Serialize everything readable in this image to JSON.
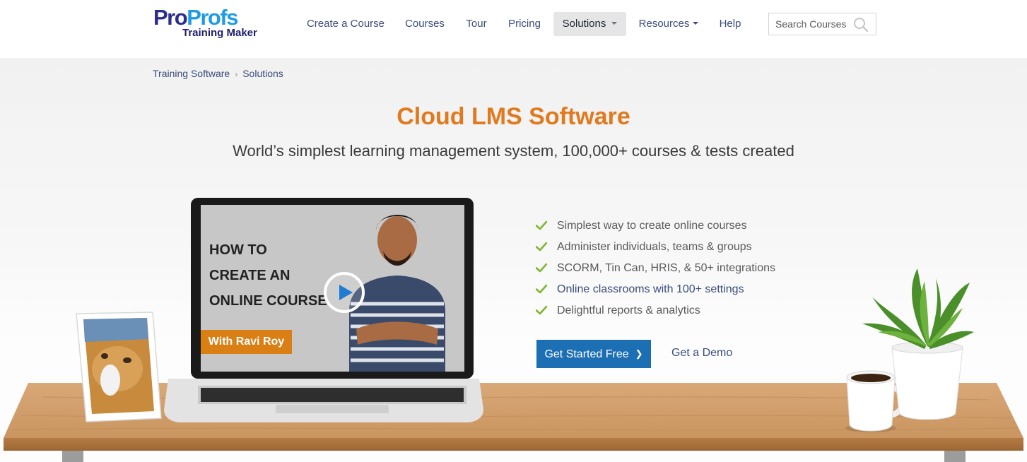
{
  "header": {
    "logo": {
      "main_pro": "Pro",
      "main_profs": "Profs",
      "sub": "Training Maker"
    },
    "nav": [
      {
        "label": "Create a Course"
      },
      {
        "label": "Courses"
      },
      {
        "label": "Tour"
      },
      {
        "label": "Pricing"
      },
      {
        "label": "Solutions",
        "active": true,
        "dropdown": true
      },
      {
        "label": "Resources",
        "dropdown": true
      },
      {
        "label": "Help"
      }
    ],
    "search": {
      "placeholder": "Search Courses",
      "icon": "search-icon"
    }
  },
  "breadcrumb": {
    "items": [
      "Training Software",
      "Solutions"
    ],
    "separator": "›"
  },
  "hero": {
    "title": "Cloud LMS Software",
    "subtitle": "World’s simplest learning management system, 100,000+ courses & tests created",
    "features": [
      "Simplest way to create online courses",
      "Administer individuals, teams & groups",
      "SCORM, Tin Can, HRIS, & 50+ integrations",
      "Online classrooms with 100+ settings",
      "Delightful reports & analytics"
    ],
    "primary_cta": "Get Started Free",
    "secondary_cta": "Get a Demo"
  },
  "video": {
    "heading_lines": [
      "HOW TO",
      "CREATE AN",
      "ONLINE COURSE"
    ],
    "byline": "With Ravi Roy"
  },
  "colors": {
    "brand_blue": "#2b2d8e",
    "brand_light_blue": "#1f9be2",
    "title_orange": "#e07a1f",
    "nav_text": "#3b4d7c",
    "primary_button": "#1d6fb3",
    "check_green": "#7ab82f",
    "byline_orange": "#d97f14"
  }
}
